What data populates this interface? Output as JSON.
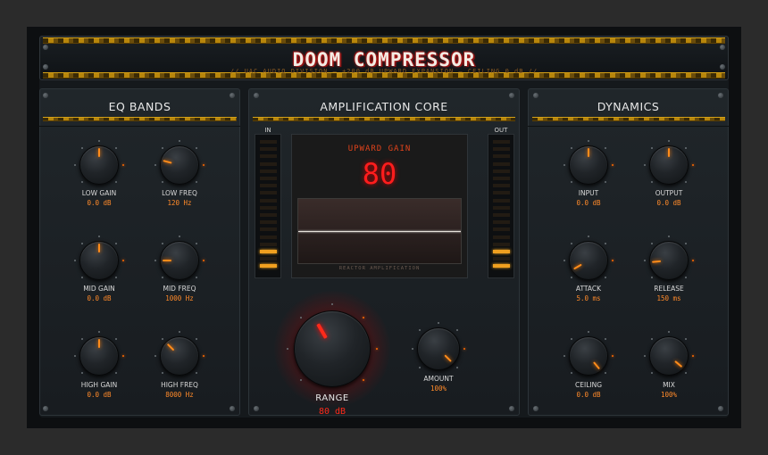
{
  "header": {
    "title": "DOOM COMPRESSOR",
    "subtitle": "// UAC AUDIO DIVISION — +200 dB UPWARD EXPANSION — CEILING 0 dB //"
  },
  "eq_panel": {
    "title": "EQ BANDS",
    "knobs": [
      {
        "label": "LOW GAIN",
        "value": "0.0 dB"
      },
      {
        "label": "LOW FREQ",
        "value": "120 Hz"
      },
      {
        "label": "MID GAIN",
        "value": "0.0 dB"
      },
      {
        "label": "MID FREQ",
        "value": "1000 Hz"
      },
      {
        "label": "HIGH GAIN",
        "value": "0.0 dB"
      },
      {
        "label": "HIGH FREQ",
        "value": "8000 Hz"
      }
    ]
  },
  "core_panel": {
    "title": "AMPLIFICATION CORE",
    "meter_in_label": "IN",
    "meter_out_label": "OUT",
    "screen_label": "UPWARD GAIN",
    "screen_value": "80",
    "screen_footer": "REACTOR AMPLIFICATION",
    "range": {
      "label": "RANGE",
      "value": "80 dB"
    },
    "amount": {
      "label": "AMOUNT",
      "value": "100%"
    }
  },
  "dynamics_panel": {
    "title": "DYNAMICS",
    "knobs": [
      {
        "label": "INPUT",
        "value": "0.0 dB"
      },
      {
        "label": "OUTPUT",
        "value": "0.0 dB"
      },
      {
        "label": "ATTACK",
        "value": "5.0 ms"
      },
      {
        "label": "RELEASE",
        "value": "150 ms"
      },
      {
        "label": "CEILING",
        "value": "0.0 dB"
      },
      {
        "label": "MIX",
        "value": "100%"
      }
    ]
  },
  "colors": {
    "accent": "#ff8c1a",
    "danger": "#ff1d1d",
    "hazard": "#b8860b"
  }
}
